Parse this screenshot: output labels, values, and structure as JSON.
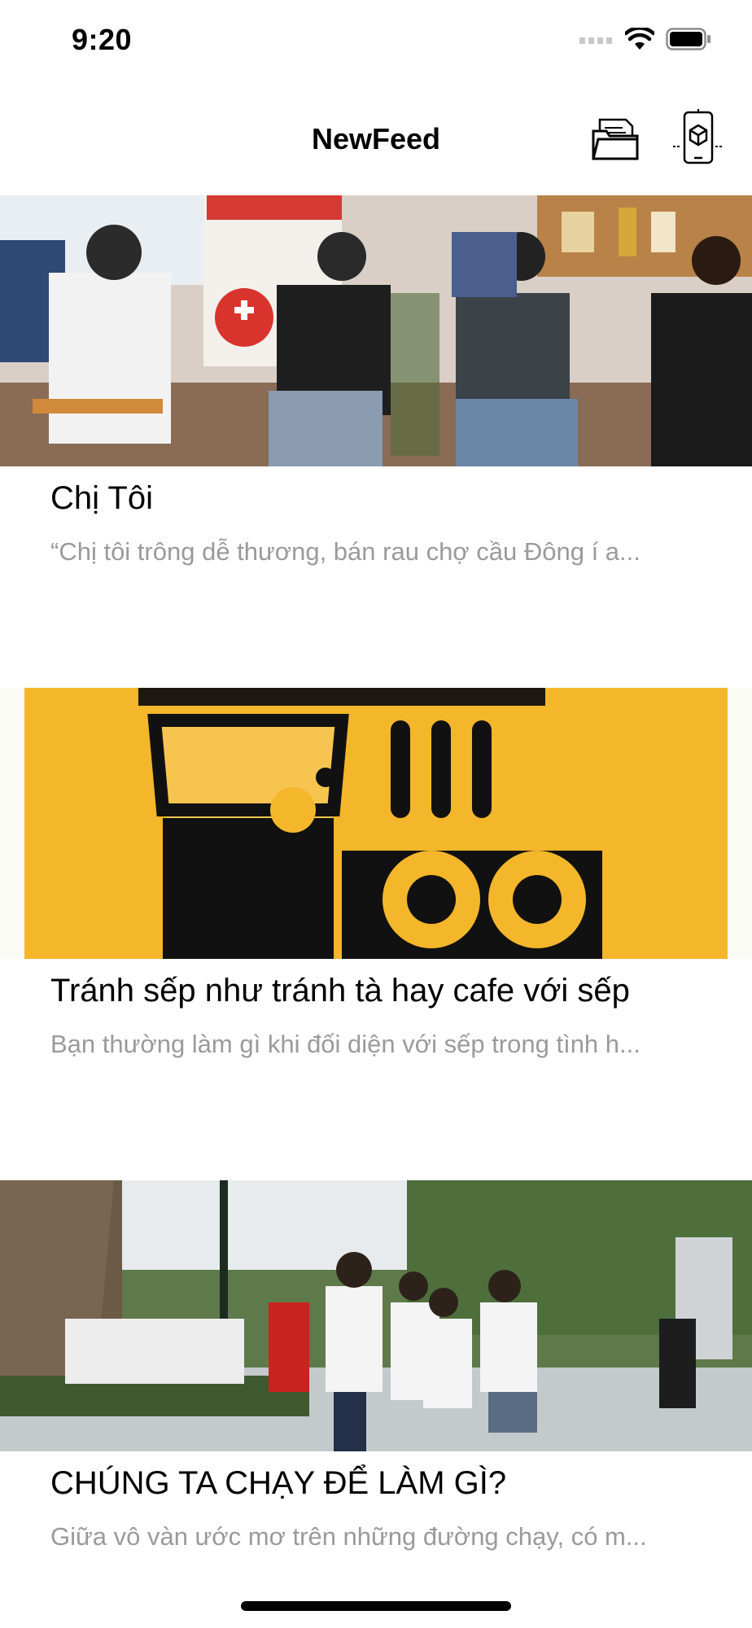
{
  "status_bar": {
    "time": "9:20",
    "icons": [
      "cellular-icon",
      "wifi-icon",
      "battery-icon"
    ]
  },
  "nav": {
    "title": "NewFeed",
    "right_buttons": [
      "folder-icon",
      "ar-cube-icon"
    ]
  },
  "feed": [
    {
      "title": "Chị Tôi",
      "description": "“Chị tôi trông dễ thương, bán rau chợ cầu Đông í a...",
      "image": "blood-donation-photo"
    },
    {
      "title": "Tránh sếp như tránh tà hay cafe với sếp",
      "description": "Bạn thường làm gì khi đối diện với sếp trong tình h...",
      "image": "coffee-talk-logo"
    },
    {
      "title": "CHÚNG TA CHẠY ĐỂ LÀM GÌ?",
      "description": "Giữa vô vàn ước mơ trên những đường chạy, có m...",
      "image": "running-event-photo"
    }
  ],
  "colors": {
    "accent_yellow": "#F4B62A",
    "description_gray": "#9a9a9a",
    "text": "#000000"
  }
}
